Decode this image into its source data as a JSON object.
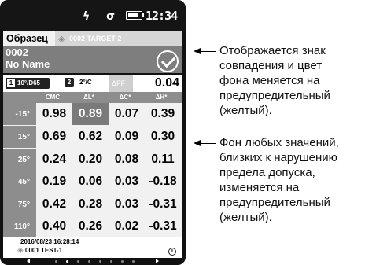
{
  "status": {
    "icons": "ϟ σ",
    "time": "12:34"
  },
  "tabs": {
    "active": "Образец",
    "target": "0002 TARGET-2"
  },
  "header": {
    "line1": "0002",
    "line2": "No Name"
  },
  "conditions": {
    "c1_num": "1",
    "c1": "10°/D65",
    "c2_num": "2",
    "c2": "2°/C",
    "deff_label": "ΔFF",
    "deff_value": "0.04"
  },
  "table": {
    "columns": [
      "CMC",
      "ΔL*",
      "ΔC*",
      "ΔH*"
    ],
    "rows": [
      {
        "angle": "-15°",
        "values": [
          "0.98",
          "0.89",
          "0.07",
          "0.39"
        ],
        "warn": [
          false,
          true,
          false,
          false
        ]
      },
      {
        "angle": "15°",
        "values": [
          "0.69",
          "0.62",
          "0.09",
          "0.30"
        ],
        "warn": [
          false,
          false,
          false,
          false
        ]
      },
      {
        "angle": "25°",
        "values": [
          "0.24",
          "0.20",
          "0.08",
          "0.11"
        ],
        "warn": [
          false,
          false,
          false,
          false
        ]
      },
      {
        "angle": "45°",
        "values": [
          "0.19",
          "0.06",
          "0.03",
          "-0.18"
        ],
        "warn": [
          false,
          false,
          false,
          false
        ]
      },
      {
        "angle": "75°",
        "values": [
          "0.42",
          "0.28",
          "0.03",
          "-0.31"
        ],
        "warn": [
          false,
          false,
          false,
          false
        ]
      },
      {
        "angle": "110°",
        "values": [
          "0.40",
          "0.26",
          "0.02",
          "-0.31"
        ],
        "warn": [
          false,
          false,
          false,
          false
        ]
      }
    ]
  },
  "footer": {
    "date": "2016/08/23 16:28:14",
    "test": "0001 TEST-1",
    "info": "i"
  },
  "annotations": {
    "a1": [
      "Отображается знак",
      "совпадения и цвет",
      "фона меняется на",
      "предупредительный",
      "(желтый)."
    ],
    "a2": [
      "Фон любых значений,",
      "близких к нарушению",
      "предела допуска,",
      "изменяется на",
      "предупредительный",
      "(желтый)."
    ]
  }
}
